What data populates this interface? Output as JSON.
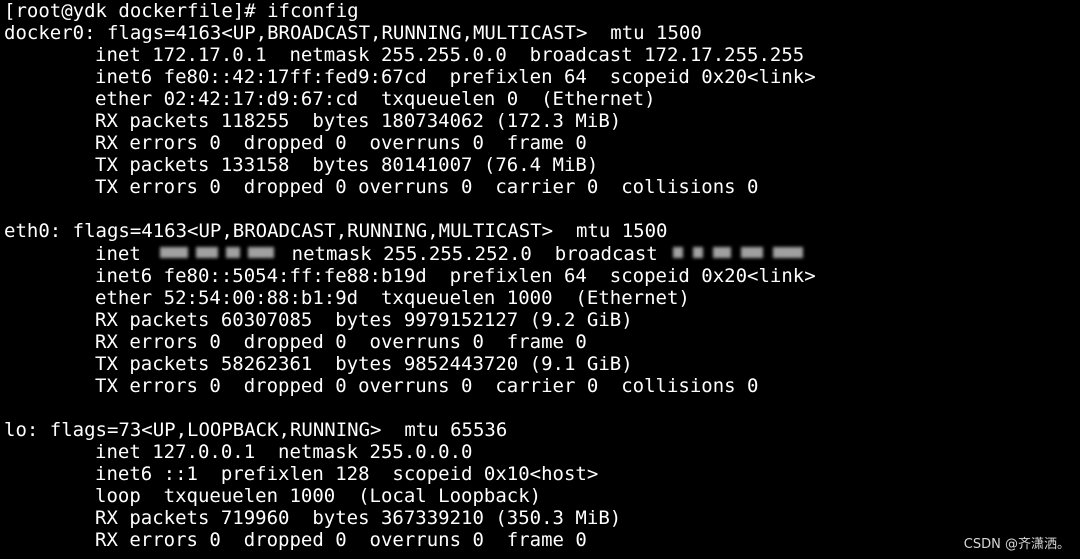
{
  "terminal": {
    "background": "#000000",
    "foreground": "#ffffff",
    "prompt_line": "[root@ydk dockerfile]# ifconfig",
    "docker0": {
      "header": "docker0: flags=4163<UP,BROADCAST,RUNNING,MULTICAST>  mtu 1500",
      "inet": "inet 172.17.0.1  netmask 255.255.0.0  broadcast 172.17.255.255",
      "inet6": "inet6 fe80::42:17ff:fed9:67cd  prefixlen 64  scopeid 0x20<link>",
      "ether": "ether 02:42:17:d9:67:cd  txqueuelen 0  (Ethernet)",
      "rx_packets": "RX packets 118255  bytes 180734062 (172.3 MiB)",
      "rx_errors": "RX errors 0  dropped 0  overruns 0  frame 0",
      "tx_packets": "TX packets 133158  bytes 80141007 (76.4 MiB)",
      "tx_errors": "TX errors 0  dropped 0 overruns 0  carrier 0  collisions 0"
    },
    "eth0": {
      "header": "eth0: flags=4163<UP,BROADCAST,RUNNING,MULTICAST>  mtu 1500",
      "inet_prefix": "inet ",
      "inet_middle": "netmask 255.255.252.0  broadcast ",
      "inet6": "inet6 fe80::5054:ff:fe88:b19d  prefixlen 64  scopeid 0x20<link>",
      "ether": "ether 52:54:00:88:b1:9d  txqueuelen 1000  (Ethernet)",
      "rx_packets": "RX packets 60307085  bytes 9979152127 (9.2 GiB)",
      "rx_errors": "RX errors 0  dropped 0  overruns 0  frame 0",
      "tx_packets": "TX packets 58262361  bytes 9852443720 (9.1 GiB)",
      "tx_errors": "TX errors 0  dropped 0 overruns 0  carrier 0  collisions 0"
    },
    "lo": {
      "header": "lo: flags=73<UP,LOOPBACK,RUNNING>  mtu 65536",
      "inet": "inet 127.0.0.1  netmask 255.0.0.0",
      "inet6": "inet6 ::1  prefixlen 128  scopeid 0x10<host>",
      "loop": "loop  txqueuelen 1000  (Local Loopback)",
      "rx_packets": "RX packets 719960  bytes 367339210 (350.3 MiB)",
      "rx_errors": "RX errors 0  dropped 0  overruns 0  frame 0"
    }
  },
  "watermark": "CSDN @齐潇洒。"
}
